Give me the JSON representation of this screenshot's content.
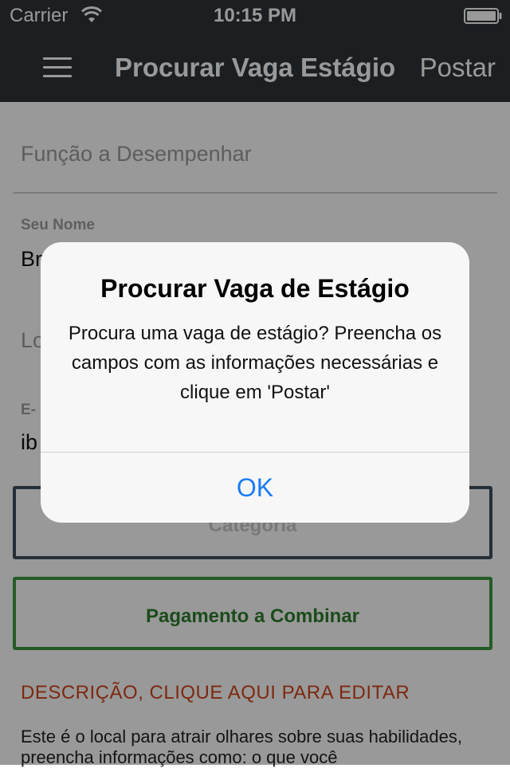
{
  "status_bar": {
    "carrier": "Carrier",
    "time": "10:15 PM",
    "wifi_icon": "wifi-icon",
    "battery_icon": "battery-icon"
  },
  "nav": {
    "menu_icon": "hamburger-menu-icon",
    "title": "Procurar Vaga Estágio",
    "post_label": "Postar"
  },
  "form": {
    "role_placeholder": "Função a Desempenhar",
    "name_label": "Seu Nome",
    "name_value": "Br",
    "location_placeholder": "Lo",
    "email_label": "E-",
    "email_value": "ib",
    "category_label": "Categoria",
    "payment_label": "Pagamento a Combinar",
    "description_title": "DESCRIÇÃO, CLIQUE AQUI PARA EDITAR",
    "description_text": "Este é o local para atrair olhares sobre suas habilidades, preencha informações como: o que você"
  },
  "alert": {
    "title": "Procurar Vaga de Estágio",
    "message": "Procura uma vaga de estágio? Preencha os campos com as informações necessárias e clique em 'Postar'",
    "ok_label": "OK"
  },
  "colors": {
    "nav_bg": "#30353a",
    "category_border": "#3c4f5c",
    "payment_border": "#3f9a3f",
    "payment_text": "#2f7d2f",
    "description_title": "#d0451b",
    "alert_button": "#1a7cf5"
  }
}
